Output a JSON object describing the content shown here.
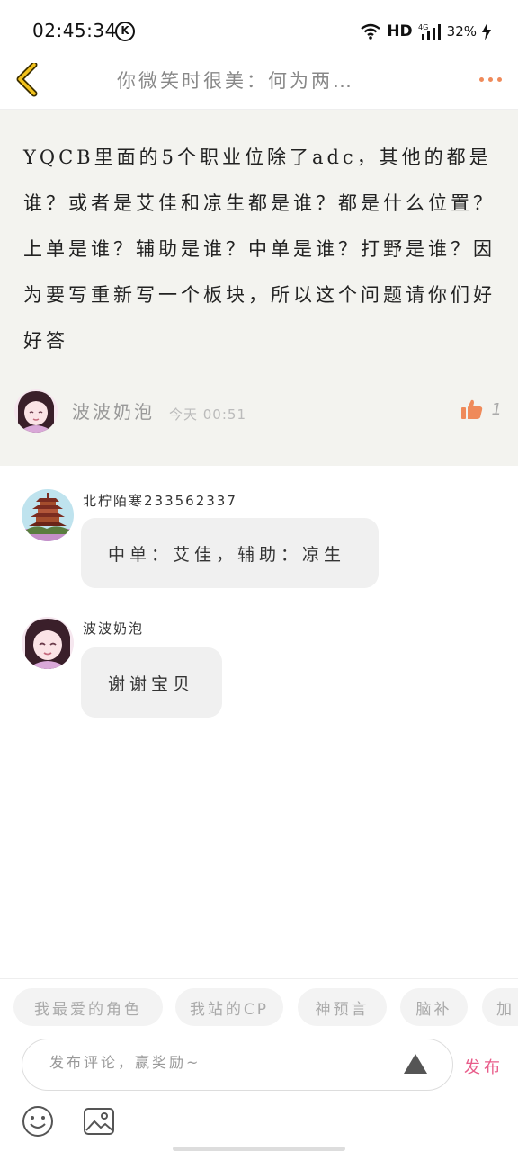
{
  "status_bar": {
    "time": "02:45:34",
    "k_badge": "K",
    "network": "HD",
    "signal_label": "4G",
    "battery": "32%"
  },
  "header": {
    "title": "你微笑时很美：何为两…"
  },
  "post": {
    "text": "YQCB里面的5个职业位除了adc，其他的都是谁？或者是艾佳和凉生都是谁？都是什么位置？上单是谁？辅助是谁？中单是谁？打野是谁？因为要写重新写一个板块，所以这个问题请你们好好答",
    "author": "波波奶泡",
    "time": "今天 00:51",
    "likes": "1"
  },
  "comments": [
    {
      "name": "北柠陌寒233562337",
      "text": "中单：艾佳，辅助：凉生"
    },
    {
      "name": "波波奶泡",
      "text": "谢谢宝贝"
    }
  ],
  "tags": [
    "我最爱的角色",
    "我站的CP",
    "神预言",
    "脑补",
    "加"
  ],
  "input": {
    "placeholder": "发布评论，赢奖励~"
  },
  "publish_label": "发布",
  "colors": {
    "accent": "#ef8a5a",
    "publish": "#e85c8a",
    "post_bg": "#f3f3ef"
  },
  "icons": [
    "back-chevron-icon",
    "more-dots-icon",
    "thumbs-up-icon",
    "expand-triangle-icon",
    "emoji-icon",
    "image-icon"
  ]
}
